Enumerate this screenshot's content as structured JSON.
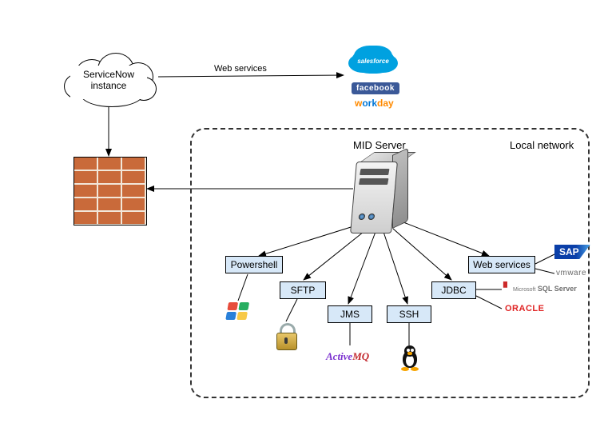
{
  "cloud": {
    "line1": "ServiceNow",
    "line2": "instance"
  },
  "arrows": {
    "web_services": "Web services"
  },
  "vendors_top": {
    "salesforce": "salesforce",
    "facebook": "facebook",
    "workday_prefix": "w",
    "workday_mid": "ork",
    "workday_day": "day"
  },
  "local_network": {
    "title": "Local network",
    "mid_server": "MID Server",
    "protocols": {
      "powershell": "Powershell",
      "sftp": "SFTP",
      "jms": "JMS",
      "ssh": "SSH",
      "jdbc": "JDBC",
      "web_services": "Web services"
    }
  },
  "vendors_right": {
    "sap": "SAP",
    "vmware": "vmware",
    "sqlserver": "SQL Server",
    "sqlserver_prefix": "Microsoft",
    "oracle": "ORACLE"
  },
  "vendors_bottom": {
    "activemq_a": "Active",
    "activemq_m": "MQ"
  }
}
